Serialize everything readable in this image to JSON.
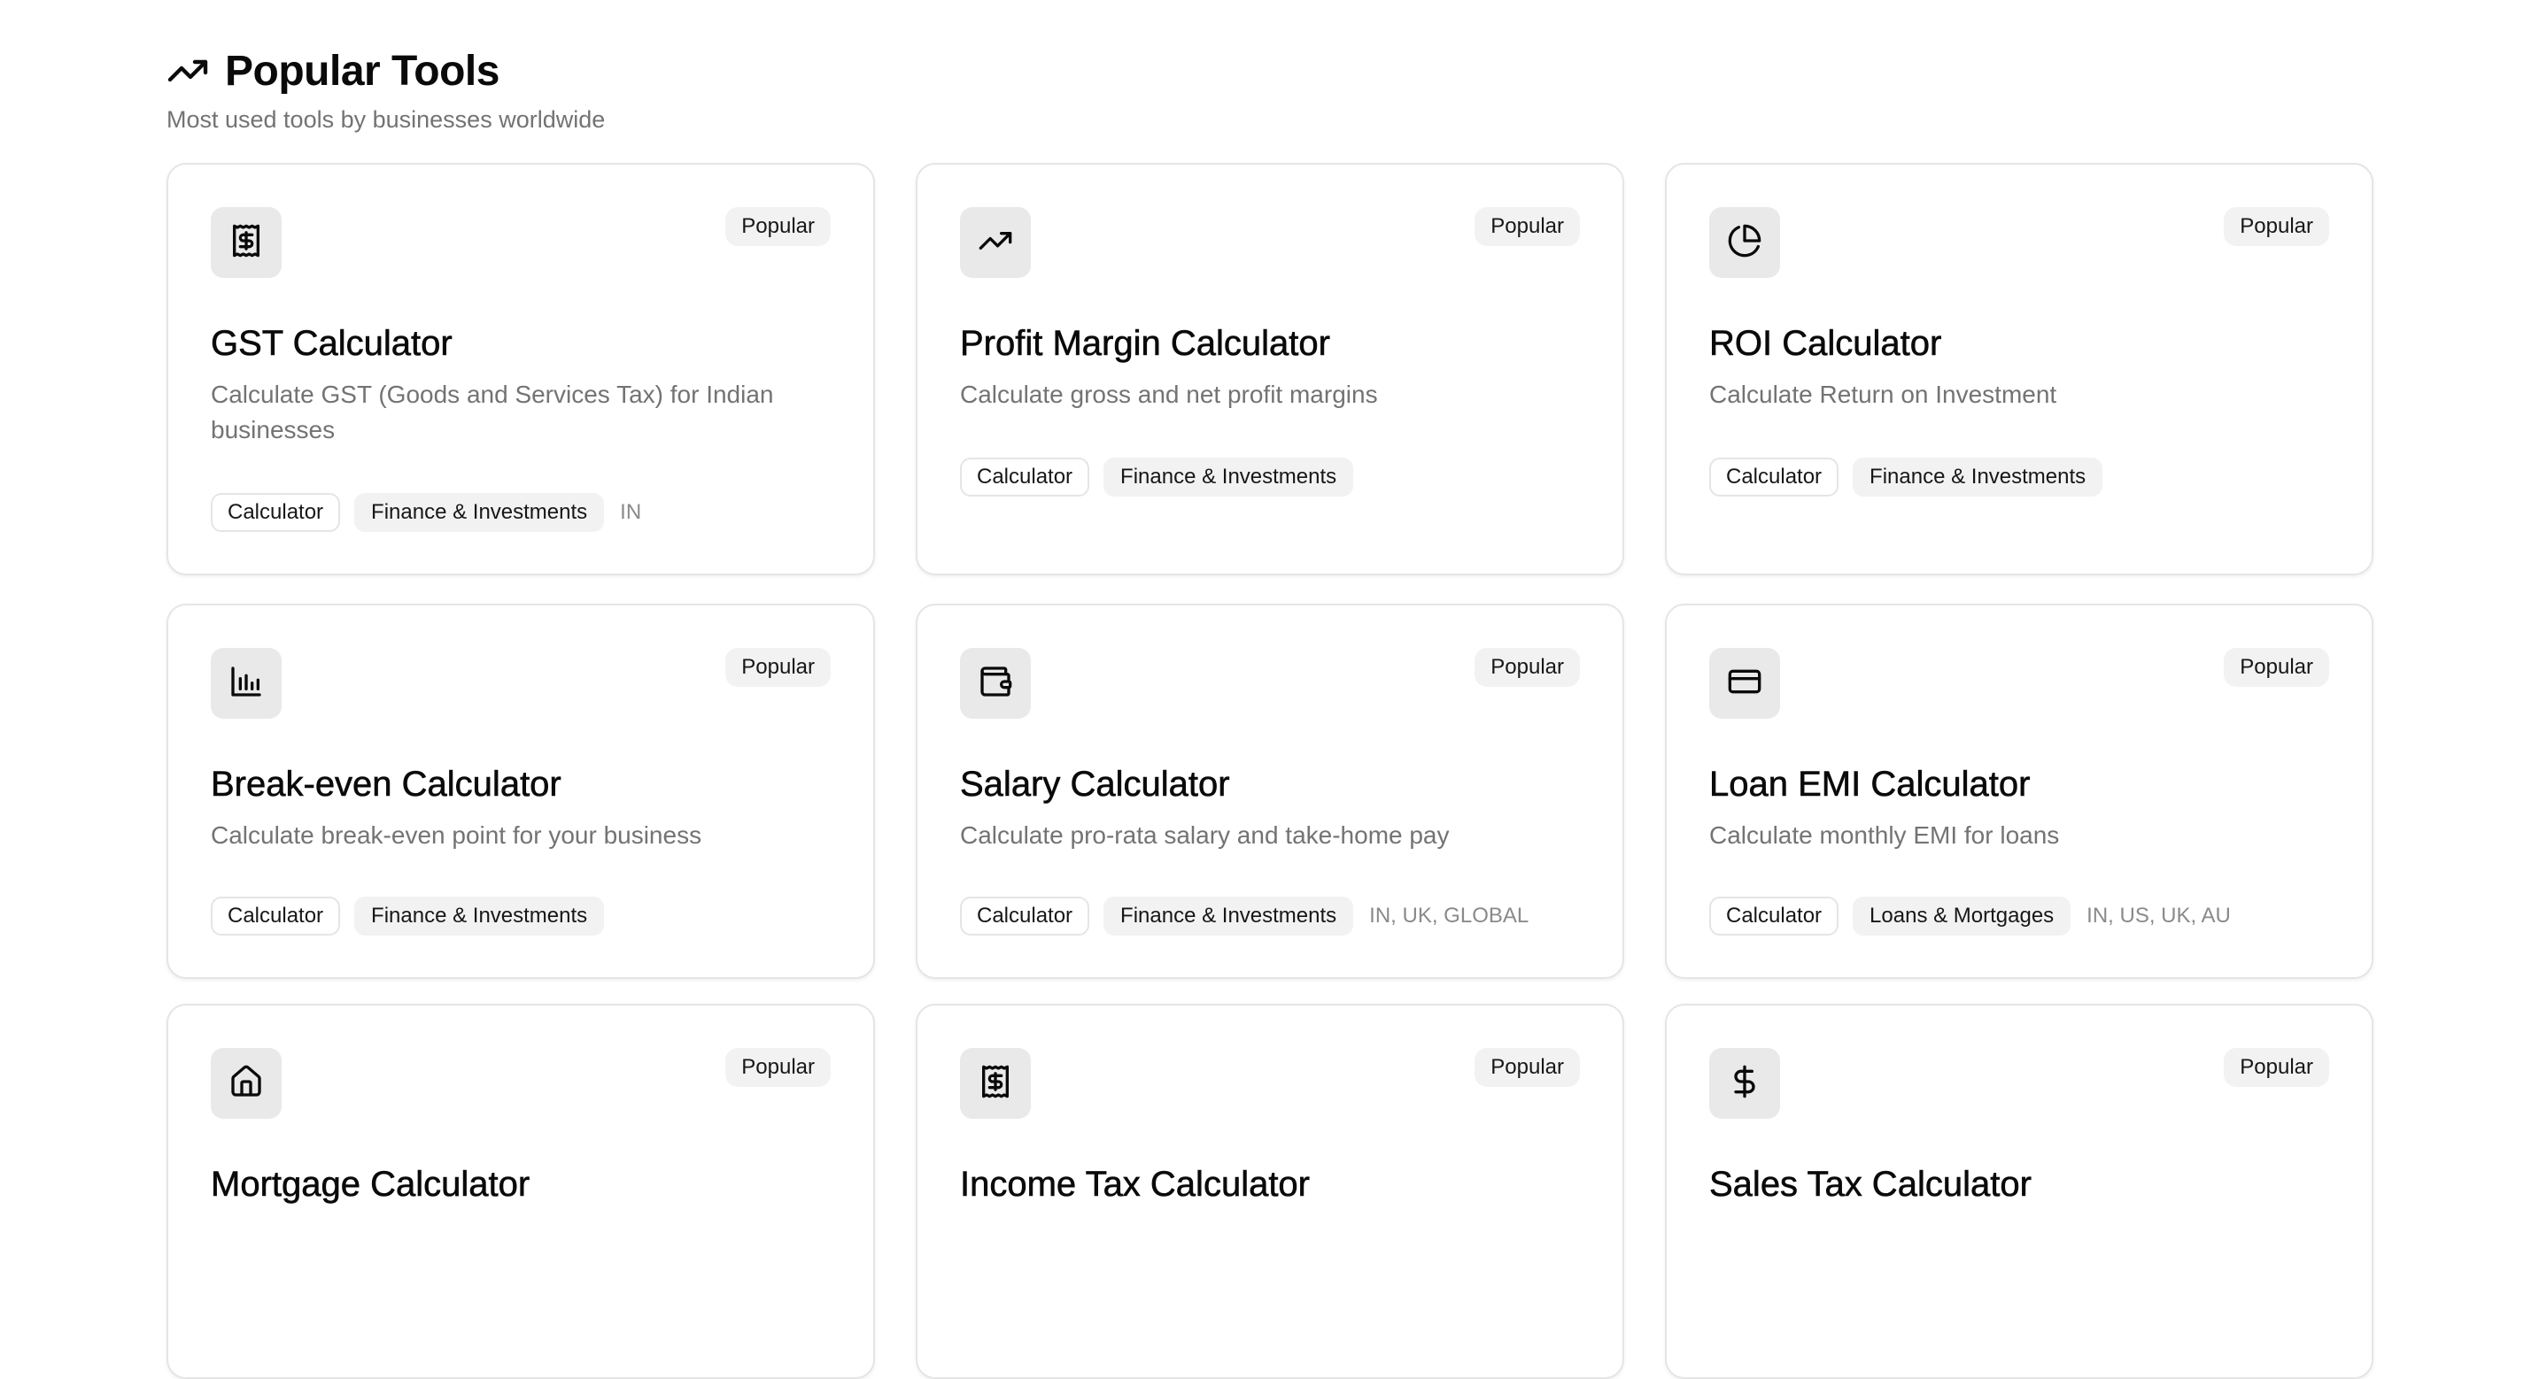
{
  "section": {
    "title": "Popular Tools",
    "title_icon": "trending-up-icon",
    "subtitle": "Most used tools by businesses worldwide"
  },
  "cards": [
    {
      "icon": "receipt-icon",
      "badge": "Popular",
      "title": "GST Calculator",
      "description": "Calculate GST (Goods and Services Tax) for Indian businesses",
      "tag_type": "Calculator",
      "tag_category": "Finance & Investments",
      "regions": "IN"
    },
    {
      "icon": "trending-up-icon",
      "badge": "Popular",
      "title": "Profit Margin Calculator",
      "description": "Calculate gross and net profit margins",
      "tag_type": "Calculator",
      "tag_category": "Finance & Investments",
      "regions": ""
    },
    {
      "icon": "pie-chart-icon",
      "badge": "Popular",
      "title": "ROI Calculator",
      "description": "Calculate Return on Investment",
      "tag_type": "Calculator",
      "tag_category": "Finance & Investments",
      "regions": ""
    },
    {
      "icon": "bar-chart-icon",
      "badge": "Popular",
      "title": "Break-even Calculator",
      "description": "Calculate break-even point for your business",
      "tag_type": "Calculator",
      "tag_category": "Finance & Investments",
      "regions": ""
    },
    {
      "icon": "wallet-icon",
      "badge": "Popular",
      "title": "Salary Calculator",
      "description": "Calculate pro-rata salary and take-home pay",
      "tag_type": "Calculator",
      "tag_category": "Finance & Investments",
      "regions": "IN, UK, GLOBAL"
    },
    {
      "icon": "credit-card-icon",
      "badge": "Popular",
      "title": "Loan EMI Calculator",
      "description": "Calculate monthly EMI for loans",
      "tag_type": "Calculator",
      "tag_category": "Loans & Mortgages",
      "regions": "IN, US, UK, AU"
    },
    {
      "icon": "home-icon",
      "badge": "Popular",
      "title": "Mortgage Calculator",
      "description": "",
      "tag_type": "",
      "tag_category": "",
      "regions": ""
    },
    {
      "icon": "receipt-icon",
      "badge": "Popular",
      "title": "Income Tax Calculator",
      "description": "",
      "tag_type": "",
      "tag_category": "",
      "regions": ""
    },
    {
      "icon": "dollar-sign-icon",
      "badge": "Popular",
      "title": "Sales Tax Calculator",
      "description": "",
      "tag_type": "",
      "tag_category": "",
      "regions": ""
    }
  ]
}
